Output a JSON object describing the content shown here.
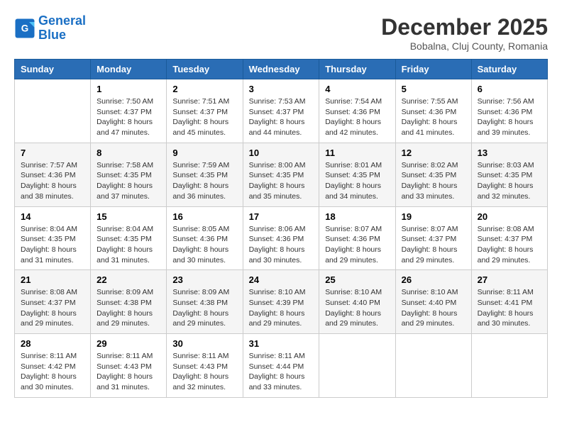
{
  "logo": {
    "line1": "General",
    "line2": "Blue"
  },
  "title": "December 2025",
  "location": "Bobalna, Cluj County, Romania",
  "days_header": [
    "Sunday",
    "Monday",
    "Tuesday",
    "Wednesday",
    "Thursday",
    "Friday",
    "Saturday"
  ],
  "weeks": [
    [
      {
        "day": "",
        "sunrise": "",
        "sunset": "",
        "daylight": ""
      },
      {
        "day": "1",
        "sunrise": "7:50 AM",
        "sunset": "4:37 PM",
        "daylight": "8 hours and 47 minutes."
      },
      {
        "day": "2",
        "sunrise": "7:51 AM",
        "sunset": "4:37 PM",
        "daylight": "8 hours and 45 minutes."
      },
      {
        "day": "3",
        "sunrise": "7:53 AM",
        "sunset": "4:37 PM",
        "daylight": "8 hours and 44 minutes."
      },
      {
        "day": "4",
        "sunrise": "7:54 AM",
        "sunset": "4:36 PM",
        "daylight": "8 hours and 42 minutes."
      },
      {
        "day": "5",
        "sunrise": "7:55 AM",
        "sunset": "4:36 PM",
        "daylight": "8 hours and 41 minutes."
      },
      {
        "day": "6",
        "sunrise": "7:56 AM",
        "sunset": "4:36 PM",
        "daylight": "8 hours and 39 minutes."
      }
    ],
    [
      {
        "day": "7",
        "sunrise": "7:57 AM",
        "sunset": "4:36 PM",
        "daylight": "8 hours and 38 minutes."
      },
      {
        "day": "8",
        "sunrise": "7:58 AM",
        "sunset": "4:35 PM",
        "daylight": "8 hours and 37 minutes."
      },
      {
        "day": "9",
        "sunrise": "7:59 AM",
        "sunset": "4:35 PM",
        "daylight": "8 hours and 36 minutes."
      },
      {
        "day": "10",
        "sunrise": "8:00 AM",
        "sunset": "4:35 PM",
        "daylight": "8 hours and 35 minutes."
      },
      {
        "day": "11",
        "sunrise": "8:01 AM",
        "sunset": "4:35 PM",
        "daylight": "8 hours and 34 minutes."
      },
      {
        "day": "12",
        "sunrise": "8:02 AM",
        "sunset": "4:35 PM",
        "daylight": "8 hours and 33 minutes."
      },
      {
        "day": "13",
        "sunrise": "8:03 AM",
        "sunset": "4:35 PM",
        "daylight": "8 hours and 32 minutes."
      }
    ],
    [
      {
        "day": "14",
        "sunrise": "8:04 AM",
        "sunset": "4:35 PM",
        "daylight": "8 hours and 31 minutes."
      },
      {
        "day": "15",
        "sunrise": "8:04 AM",
        "sunset": "4:35 PM",
        "daylight": "8 hours and 31 minutes."
      },
      {
        "day": "16",
        "sunrise": "8:05 AM",
        "sunset": "4:36 PM",
        "daylight": "8 hours and 30 minutes."
      },
      {
        "day": "17",
        "sunrise": "8:06 AM",
        "sunset": "4:36 PM",
        "daylight": "8 hours and 30 minutes."
      },
      {
        "day": "18",
        "sunrise": "8:07 AM",
        "sunset": "4:36 PM",
        "daylight": "8 hours and 29 minutes."
      },
      {
        "day": "19",
        "sunrise": "8:07 AM",
        "sunset": "4:37 PM",
        "daylight": "8 hours and 29 minutes."
      },
      {
        "day": "20",
        "sunrise": "8:08 AM",
        "sunset": "4:37 PM",
        "daylight": "8 hours and 29 minutes."
      }
    ],
    [
      {
        "day": "21",
        "sunrise": "8:08 AM",
        "sunset": "4:37 PM",
        "daylight": "8 hours and 29 minutes."
      },
      {
        "day": "22",
        "sunrise": "8:09 AM",
        "sunset": "4:38 PM",
        "daylight": "8 hours and 29 minutes."
      },
      {
        "day": "23",
        "sunrise": "8:09 AM",
        "sunset": "4:38 PM",
        "daylight": "8 hours and 29 minutes."
      },
      {
        "day": "24",
        "sunrise": "8:10 AM",
        "sunset": "4:39 PM",
        "daylight": "8 hours and 29 minutes."
      },
      {
        "day": "25",
        "sunrise": "8:10 AM",
        "sunset": "4:40 PM",
        "daylight": "8 hours and 29 minutes."
      },
      {
        "day": "26",
        "sunrise": "8:10 AM",
        "sunset": "4:40 PM",
        "daylight": "8 hours and 29 minutes."
      },
      {
        "day": "27",
        "sunrise": "8:11 AM",
        "sunset": "4:41 PM",
        "daylight": "8 hours and 30 minutes."
      }
    ],
    [
      {
        "day": "28",
        "sunrise": "8:11 AM",
        "sunset": "4:42 PM",
        "daylight": "8 hours and 30 minutes."
      },
      {
        "day": "29",
        "sunrise": "8:11 AM",
        "sunset": "4:43 PM",
        "daylight": "8 hours and 31 minutes."
      },
      {
        "day": "30",
        "sunrise": "8:11 AM",
        "sunset": "4:43 PM",
        "daylight": "8 hours and 32 minutes."
      },
      {
        "day": "31",
        "sunrise": "8:11 AM",
        "sunset": "4:44 PM",
        "daylight": "8 hours and 33 minutes."
      },
      {
        "day": "",
        "sunrise": "",
        "sunset": "",
        "daylight": ""
      },
      {
        "day": "",
        "sunrise": "",
        "sunset": "",
        "daylight": ""
      },
      {
        "day": "",
        "sunrise": "",
        "sunset": "",
        "daylight": ""
      }
    ]
  ]
}
